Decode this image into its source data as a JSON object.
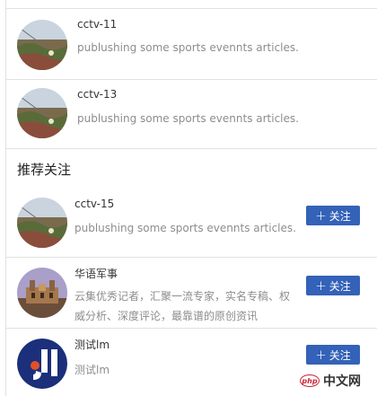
{
  "feed": [
    {
      "name": "cctv-11",
      "description": "publushing some sports evennts articles.",
      "avatar_icon": "landscape-avatar"
    },
    {
      "name": "cctv-13",
      "description": "publushing some sports evennts articles.",
      "avatar_icon": "landscape-avatar"
    }
  ],
  "recommend": {
    "title": "推荐关注",
    "follow_label": "关注",
    "follow_icon": "plus-icon",
    "button_color": "#3462b8",
    "items": [
      {
        "name": "cctv-15",
        "description": "publushing some sports evennts articles.",
        "avatar_icon": "landscape-avatar"
      },
      {
        "name": "华语军事",
        "description": "云集优秀记者，汇聚一流专家，实名专稿、权威分析、深度评论，最靠谱的原创资讯",
        "avatar_icon": "building-avatar"
      },
      {
        "name": "测试lm",
        "description": "测试lm",
        "avatar_icon": "logo-avatar"
      }
    ]
  },
  "watermark": {
    "badge": "php",
    "text": "中文网"
  }
}
